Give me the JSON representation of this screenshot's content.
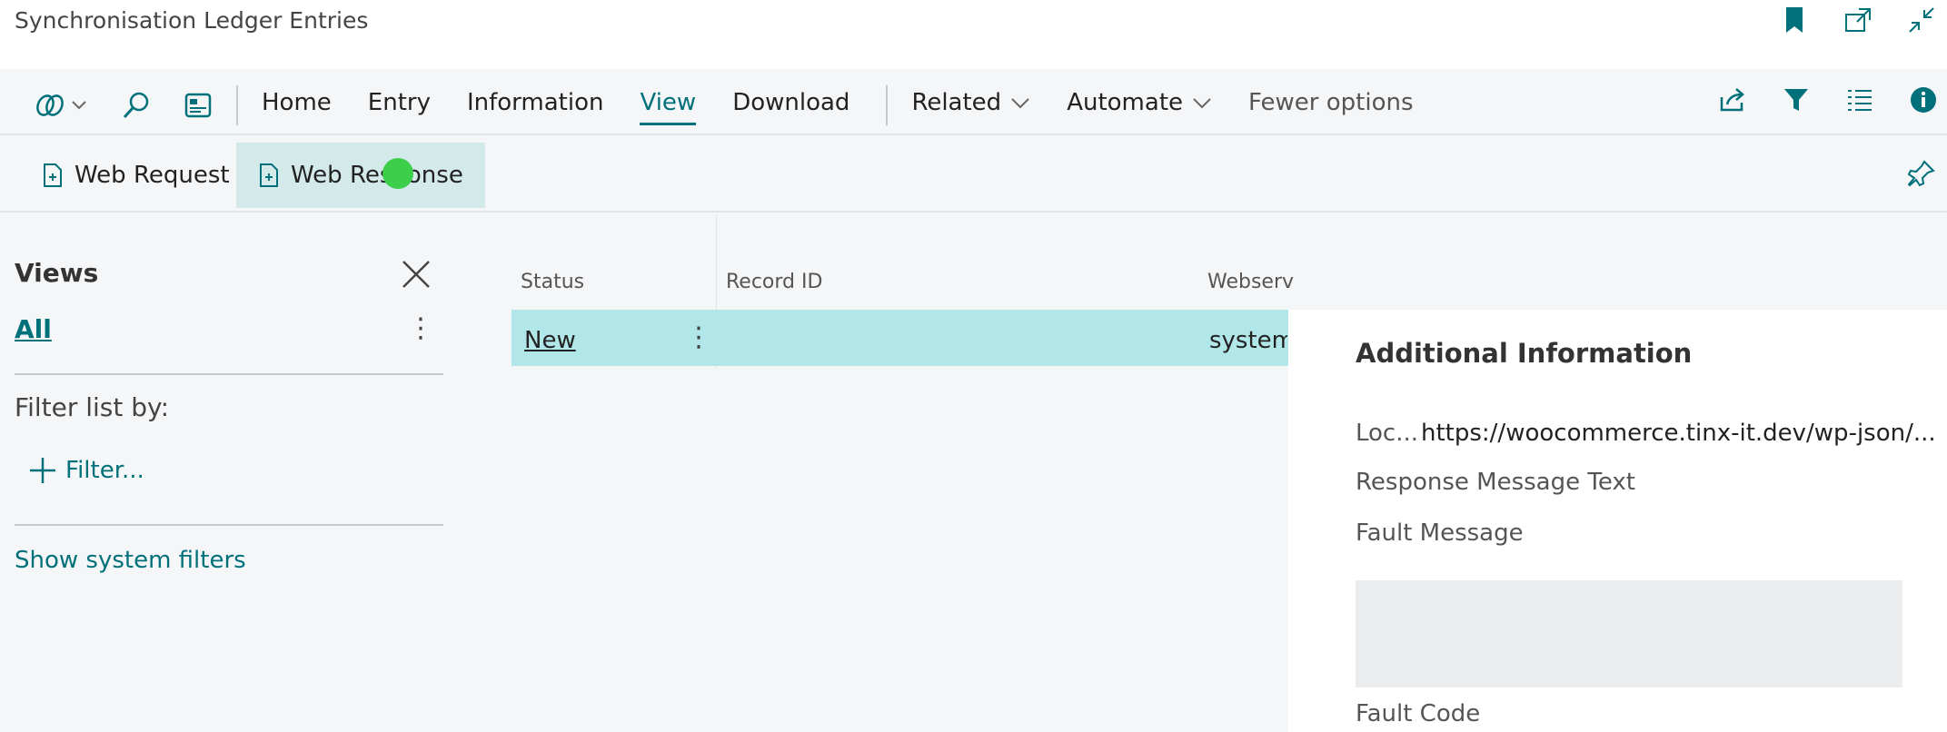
{
  "window": {
    "title": "Synchronisation Ledger Entries"
  },
  "actionbar": {
    "menu": [
      "Home",
      "Entry",
      "Information",
      "View",
      "Download"
    ],
    "active_index": 3,
    "related_label": "Related",
    "automate_label": "Automate",
    "fewer_options_label": "Fewer options"
  },
  "subbar": {
    "web_request_label": "Web Request",
    "web_response_label": "Web Response"
  },
  "views": {
    "title": "Views",
    "all_label": "All",
    "filter_label": "Filter list by:",
    "add_filter_label": "Filter...",
    "show_system_filters_label": "Show system filters"
  },
  "table": {
    "columns": [
      "Status",
      "Record ID",
      "Webserv"
    ],
    "rows": [
      {
        "status": "New",
        "record_id": "",
        "webservice": "system_"
      }
    ]
  },
  "factbox": {
    "title": "Additional Information",
    "location_label": "Loc...",
    "location_value": "https://woocommerce.tinx-it.dev/wp-json/...",
    "response_message_label": "Response Message Text",
    "fault_message_label": "Fault Message",
    "fault_code_label": "Fault Code"
  },
  "colors": {
    "accent": "#00707a",
    "selected_row": "#b2e7ea",
    "active_subbutton": "#d3e9ea",
    "cursor": "#3ecf4a"
  }
}
